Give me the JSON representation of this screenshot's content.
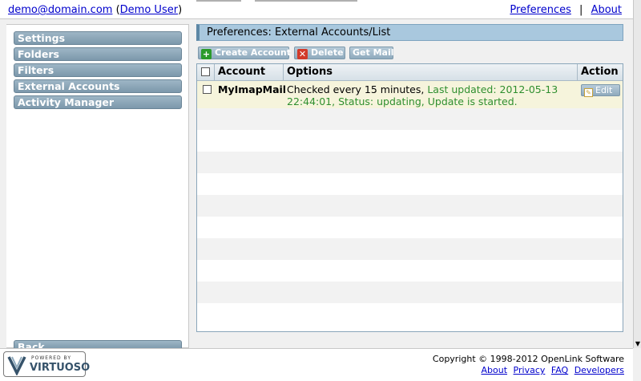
{
  "topbar": {
    "user_email": "demo@domain.com",
    "user_name_open": "(",
    "user_name": "Demo User",
    "user_name_close": ")",
    "preferences": "Preferences",
    "separator": "|",
    "about": "About"
  },
  "sidebar": {
    "items": [
      {
        "label": "Settings"
      },
      {
        "label": "Folders"
      },
      {
        "label": "Filters"
      },
      {
        "label": "External Accounts"
      },
      {
        "label": "Activity Manager"
      }
    ],
    "back_label": "Back"
  },
  "main": {
    "title": "Preferences: External Accounts/List",
    "toolbar": {
      "create_account": "Create Account",
      "delete": "Delete",
      "get_mail": "Get Mail"
    },
    "table": {
      "headers": {
        "account": "Account",
        "options": "Options",
        "action": "Action"
      },
      "rows": [
        {
          "account": "MyImapMail",
          "options_prefix": "Checked every 15 minutes, ",
          "options_status": "Last updated: 2012-05-13 22:44:01, Status: updating, Update is started.",
          "action": "Edit"
        }
      ]
    }
  },
  "footer": {
    "badge_top": "POWERED BY",
    "badge_name": "VIRTUOSO",
    "copyright": "Copyright © 1998-2012 OpenLink Software",
    "links": {
      "about": "About",
      "privacy": "Privacy",
      "faq": "FAQ",
      "developers": "Developers"
    }
  },
  "colors": {
    "accent": "#a9c8de",
    "button": "#8faabd",
    "status_green": "#2f8f2f",
    "selected_row": "#f6f4dc"
  },
  "icons": {
    "create": "plus-icon",
    "delete": "x-icon",
    "edit": "pencil-icon"
  }
}
